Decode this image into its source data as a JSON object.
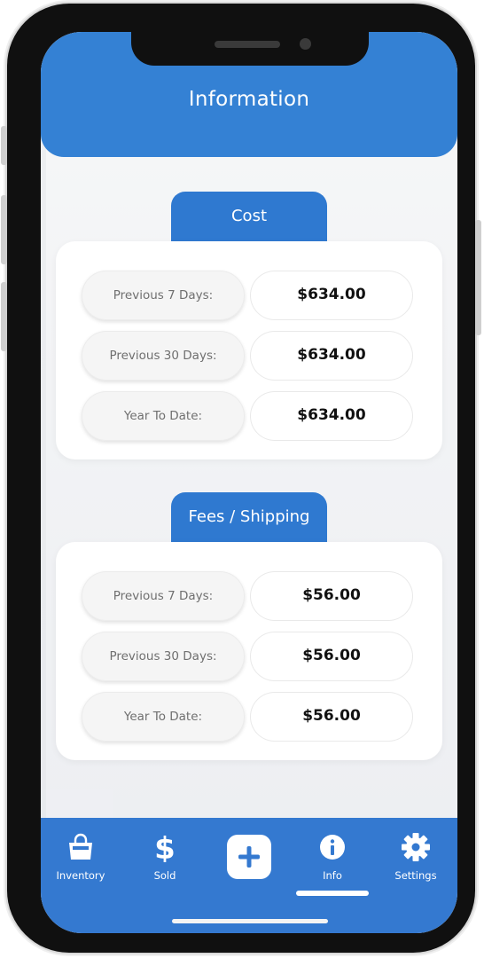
{
  "header": {
    "title": "Information"
  },
  "sections": [
    {
      "title": "Cost",
      "rows": [
        {
          "label": "Previous 7 Days:",
          "value": "$634.00"
        },
        {
          "label": "Previous 30 Days:",
          "value": "$634.00"
        },
        {
          "label": "Year To Date:",
          "value": "$634.00"
        }
      ]
    },
    {
      "title": "Fees / Shipping",
      "rows": [
        {
          "label": "Previous 7 Days:",
          "value": "$56.00"
        },
        {
          "label": "Previous 30 Days:",
          "value": "$56.00"
        },
        {
          "label": "Year To Date:",
          "value": "$56.00"
        }
      ]
    }
  ],
  "nav": {
    "items": [
      {
        "label": "Inventory",
        "icon": "shopping-bag-icon"
      },
      {
        "label": "Sold",
        "icon": "dollar-icon"
      },
      {
        "label": "",
        "icon": "plus-icon"
      },
      {
        "label": "Info",
        "icon": "info-icon"
      },
      {
        "label": "Settings",
        "icon": "gear-icon"
      }
    ],
    "active": "Info"
  },
  "colors": {
    "primary": "#3481d4",
    "tab": "#2f79d0",
    "background": "#f1f2f4"
  }
}
